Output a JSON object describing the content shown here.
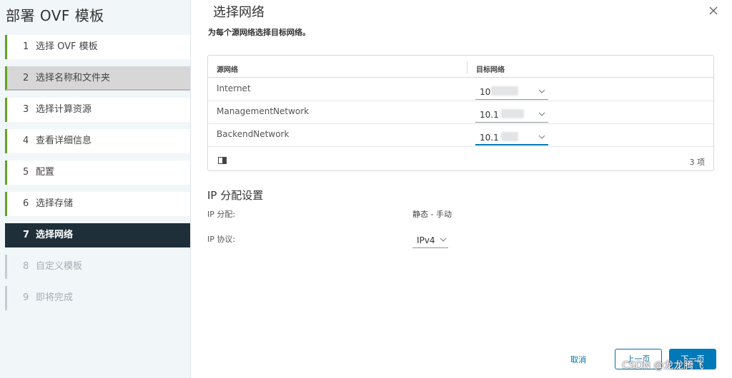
{
  "wizard": {
    "title": "部署 OVF 模板",
    "steps": [
      {
        "num": "1",
        "label": "选择 OVF 模板"
      },
      {
        "num": "2",
        "label": "选择名称和文件夹"
      },
      {
        "num": "3",
        "label": "选择计算资源"
      },
      {
        "num": "4",
        "label": "查看详细信息"
      },
      {
        "num": "5",
        "label": "配置"
      },
      {
        "num": "6",
        "label": "选择存储"
      },
      {
        "num": "7",
        "label": "选择网络"
      },
      {
        "num": "8",
        "label": "自定义模板"
      },
      {
        "num": "9",
        "label": "即将完成"
      }
    ]
  },
  "page": {
    "title": "选择网络",
    "subtitle": "为每个源网络选择目标网络。"
  },
  "grid": {
    "headers": {
      "source": "源网络",
      "target": "目标网络"
    },
    "rows": [
      {
        "source": "Internet",
        "target": "10"
      },
      {
        "source": "ManagementNetwork",
        "target": "10.1"
      },
      {
        "source": "BackendNetwork",
        "target": "10.1"
      }
    ],
    "count": "3 项"
  },
  "ip": {
    "section_title": "IP 分配设置",
    "allocation_label": "IP 分配:",
    "allocation_value": "静态 - 手动",
    "protocol_label": "IP 协议:",
    "protocol_value": "IPv4"
  },
  "footer": {
    "cancel": "取消",
    "back": "上一页",
    "next": "下一页"
  },
  "watermark": "CSDN @龙龙腾飞",
  "colors": {
    "accent": "#0079b8",
    "active_step_bg": "#1f2f3a",
    "completed_step_bar": "#62a420"
  }
}
